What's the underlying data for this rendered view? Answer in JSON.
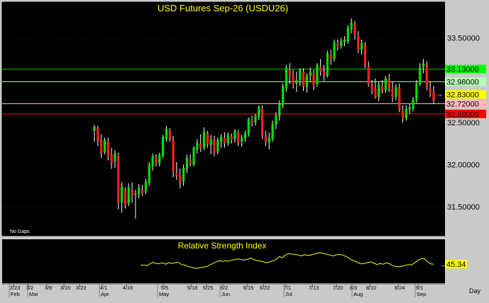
{
  "chart_data": {
    "type": "candlestick",
    "title": "USD Futures Sep-26  (USDU26)",
    "note": "No Gaps",
    "period_label": "Day",
    "y_ticks": [
      "33.50000",
      "33.00000",
      "32.50000",
      "32.00000",
      "31.50000"
    ],
    "ylim": [
      31.2,
      33.78
    ],
    "x_ticks": [
      "2/23",
      "3/2",
      "3/9",
      "3/16",
      "3/23",
      "4/1",
      "4/16",
      "5/5",
      "5/18",
      "5/25",
      "6/2",
      "6/15",
      "6/22",
      "7/1",
      "7/13",
      "7/20",
      "8/3",
      "8/10",
      "8/24",
      "9/1"
    ],
    "months": [
      "Feb",
      "Mar",
      "Apr",
      "May",
      "Jun",
      "Jul",
      "Aug",
      "Sep"
    ],
    "levels": [
      {
        "value": 33.13,
        "label": "33.13000",
        "color": "#00c800",
        "label_bg": "#00ff00"
      },
      {
        "value": 32.98,
        "label": "32.98000",
        "color": "#a8f0a8",
        "label_bg": "#b4ffb4"
      },
      {
        "value": 32.83,
        "label": "32.83000",
        "color": null,
        "label_bg": "#ffff00"
      },
      {
        "value": 32.72,
        "label": "32.72000",
        "color": "#ffbcbc",
        "label_bg": "#ffb8b8"
      },
      {
        "value": 32.6,
        "label": "32.60000",
        "color": "#ff0000",
        "label_bg": "#ff0000"
      }
    ],
    "candles": [
      {
        "o": 32.4,
        "h": 32.47,
        "l": 32.27,
        "c": 32.45
      },
      {
        "o": 32.43,
        "h": 32.46,
        "l": 32.22,
        "c": 32.28
      },
      {
        "o": 32.3,
        "h": 32.36,
        "l": 32.08,
        "c": 32.14
      },
      {
        "o": 32.15,
        "h": 32.32,
        "l": 32.12,
        "c": 32.29
      },
      {
        "o": 32.27,
        "h": 32.32,
        "l": 32.05,
        "c": 32.1
      },
      {
        "o": 32.12,
        "h": 32.2,
        "l": 31.95,
        "c": 32.02
      },
      {
        "o": 32.04,
        "h": 32.17,
        "l": 31.96,
        "c": 32.13
      },
      {
        "o": 32.1,
        "h": 32.14,
        "l": 31.47,
        "c": 31.55
      },
      {
        "o": 31.55,
        "h": 31.79,
        "l": 31.43,
        "c": 31.74
      },
      {
        "o": 31.7,
        "h": 31.73,
        "l": 31.48,
        "c": 31.52
      },
      {
        "o": 31.54,
        "h": 31.78,
        "l": 31.51,
        "c": 31.73
      },
      {
        "o": 31.7,
        "h": 31.79,
        "l": 31.55,
        "c": 31.63
      },
      {
        "o": 31.64,
        "h": 31.7,
        "l": 31.36,
        "c": 31.66
      },
      {
        "o": 31.65,
        "h": 31.77,
        "l": 31.6,
        "c": 31.73
      },
      {
        "o": 31.71,
        "h": 31.76,
        "l": 31.63,
        "c": 31.66
      },
      {
        "o": 31.68,
        "h": 31.83,
        "l": 31.65,
        "c": 31.8
      },
      {
        "o": 31.78,
        "h": 32.03,
        "l": 31.75,
        "c": 32.0
      },
      {
        "o": 31.98,
        "h": 32.13,
        "l": 31.93,
        "c": 32.1
      },
      {
        "o": 32.08,
        "h": 32.12,
        "l": 31.98,
        "c": 32.02
      },
      {
        "o": 32.01,
        "h": 32.14,
        "l": 31.98,
        "c": 32.12
      },
      {
        "o": 32.1,
        "h": 32.35,
        "l": 32.08,
        "c": 32.33
      },
      {
        "o": 32.3,
        "h": 32.46,
        "l": 32.27,
        "c": 32.42
      },
      {
        "o": 32.4,
        "h": 32.43,
        "l": 32.27,
        "c": 32.3
      },
      {
        "o": 32.3,
        "h": 32.34,
        "l": 31.85,
        "c": 31.92
      },
      {
        "o": 31.9,
        "h": 32.03,
        "l": 31.82,
        "c": 31.87
      },
      {
        "o": 31.88,
        "h": 31.95,
        "l": 31.72,
        "c": 31.8
      },
      {
        "o": 31.8,
        "h": 32.0,
        "l": 31.75,
        "c": 31.96
      },
      {
        "o": 31.95,
        "h": 32.12,
        "l": 31.9,
        "c": 32.08
      },
      {
        "o": 32.05,
        "h": 32.12,
        "l": 31.98,
        "c": 32.01
      },
      {
        "o": 32.0,
        "h": 32.22,
        "l": 31.98,
        "c": 32.2
      },
      {
        "o": 32.18,
        "h": 32.3,
        "l": 32.13,
        "c": 32.26
      },
      {
        "o": 32.25,
        "h": 32.36,
        "l": 32.15,
        "c": 32.19
      },
      {
        "o": 32.2,
        "h": 32.44,
        "l": 32.17,
        "c": 32.39
      },
      {
        "o": 32.37,
        "h": 32.4,
        "l": 32.2,
        "c": 32.24
      },
      {
        "o": 32.23,
        "h": 32.35,
        "l": 32.12,
        "c": 32.3
      },
      {
        "o": 32.3,
        "h": 32.34,
        "l": 32.1,
        "c": 32.14
      },
      {
        "o": 32.15,
        "h": 32.32,
        "l": 32.12,
        "c": 32.29
      },
      {
        "o": 32.27,
        "h": 32.36,
        "l": 32.2,
        "c": 32.33
      },
      {
        "o": 32.32,
        "h": 32.38,
        "l": 32.2,
        "c": 32.25
      },
      {
        "o": 32.25,
        "h": 32.38,
        "l": 32.22,
        "c": 32.35
      },
      {
        "o": 32.33,
        "h": 32.37,
        "l": 32.25,
        "c": 32.3
      },
      {
        "o": 32.3,
        "h": 32.42,
        "l": 32.26,
        "c": 32.4
      },
      {
        "o": 32.38,
        "h": 32.41,
        "l": 32.22,
        "c": 32.26
      },
      {
        "o": 32.27,
        "h": 32.35,
        "l": 32.21,
        "c": 32.32
      },
      {
        "o": 32.31,
        "h": 32.4,
        "l": 32.27,
        "c": 32.37
      },
      {
        "o": 32.36,
        "h": 32.56,
        "l": 32.33,
        "c": 32.54
      },
      {
        "o": 32.52,
        "h": 32.58,
        "l": 32.45,
        "c": 32.5
      },
      {
        "o": 32.5,
        "h": 32.6,
        "l": 32.46,
        "c": 32.58
      },
      {
        "o": 32.56,
        "h": 32.7,
        "l": 32.53,
        "c": 32.68
      },
      {
        "o": 32.66,
        "h": 32.7,
        "l": 32.3,
        "c": 32.35
      },
      {
        "o": 32.34,
        "h": 32.4,
        "l": 32.22,
        "c": 32.27
      },
      {
        "o": 32.26,
        "h": 32.38,
        "l": 32.18,
        "c": 32.32
      },
      {
        "o": 32.3,
        "h": 32.52,
        "l": 32.27,
        "c": 32.48
      },
      {
        "o": 32.47,
        "h": 32.62,
        "l": 32.42,
        "c": 32.58
      },
      {
        "o": 32.57,
        "h": 32.76,
        "l": 32.52,
        "c": 32.72
      },
      {
        "o": 32.7,
        "h": 32.96,
        "l": 32.67,
        "c": 32.93
      },
      {
        "o": 32.9,
        "h": 33.18,
        "l": 32.86,
        "c": 33.15
      },
      {
        "o": 33.13,
        "h": 33.2,
        "l": 32.95,
        "c": 33.05
      },
      {
        "o": 33.05,
        "h": 33.12,
        "l": 32.9,
        "c": 32.95
      },
      {
        "o": 32.96,
        "h": 33.1,
        "l": 32.86,
        "c": 33.0
      },
      {
        "o": 33.0,
        "h": 33.14,
        "l": 32.93,
        "c": 33.12
      },
      {
        "o": 33.1,
        "h": 33.14,
        "l": 32.87,
        "c": 32.92
      },
      {
        "o": 32.92,
        "h": 33.08,
        "l": 32.85,
        "c": 33.05
      },
      {
        "o": 33.05,
        "h": 33.15,
        "l": 32.98,
        "c": 33.1
      },
      {
        "o": 33.08,
        "h": 33.12,
        "l": 32.88,
        "c": 32.94
      },
      {
        "o": 32.95,
        "h": 33.2,
        "l": 32.92,
        "c": 33.18
      },
      {
        "o": 33.16,
        "h": 33.25,
        "l": 33.05,
        "c": 33.1
      },
      {
        "o": 33.1,
        "h": 33.18,
        "l": 32.99,
        "c": 33.05
      },
      {
        "o": 33.05,
        "h": 33.35,
        "l": 33.03,
        "c": 33.32
      },
      {
        "o": 33.3,
        "h": 33.36,
        "l": 33.18,
        "c": 33.24
      },
      {
        "o": 33.25,
        "h": 33.48,
        "l": 33.22,
        "c": 33.45
      },
      {
        "o": 33.43,
        "h": 33.48,
        "l": 33.35,
        "c": 33.4
      },
      {
        "o": 33.4,
        "h": 33.5,
        "l": 33.37,
        "c": 33.46
      },
      {
        "o": 33.45,
        "h": 33.52,
        "l": 33.4,
        "c": 33.48
      },
      {
        "o": 33.46,
        "h": 33.65,
        "l": 33.43,
        "c": 33.62
      },
      {
        "o": 33.6,
        "h": 33.73,
        "l": 33.55,
        "c": 33.68
      },
      {
        "o": 33.66,
        "h": 33.7,
        "l": 33.48,
        "c": 33.54
      },
      {
        "o": 33.53,
        "h": 33.58,
        "l": 33.32,
        "c": 33.36
      },
      {
        "o": 33.36,
        "h": 33.48,
        "l": 33.3,
        "c": 33.44
      },
      {
        "o": 33.42,
        "h": 33.45,
        "l": 33.14,
        "c": 33.17
      },
      {
        "o": 33.16,
        "h": 33.22,
        "l": 32.92,
        "c": 32.95
      },
      {
        "o": 32.95,
        "h": 33.0,
        "l": 32.83,
        "c": 32.88
      },
      {
        "o": 32.9,
        "h": 33.02,
        "l": 32.78,
        "c": 32.8
      },
      {
        "o": 32.8,
        "h": 32.98,
        "l": 32.75,
        "c": 32.95
      },
      {
        "o": 32.93,
        "h": 33.0,
        "l": 32.84,
        "c": 32.88
      },
      {
        "o": 32.88,
        "h": 33.05,
        "l": 32.85,
        "c": 33.02
      },
      {
        "o": 33.0,
        "h": 33.07,
        "l": 32.86,
        "c": 32.9
      },
      {
        "o": 32.9,
        "h": 32.98,
        "l": 32.74,
        "c": 32.8
      },
      {
        "o": 32.8,
        "h": 32.95,
        "l": 32.76,
        "c": 32.92
      },
      {
        "o": 32.9,
        "h": 32.96,
        "l": 32.62,
        "c": 32.65
      },
      {
        "o": 32.64,
        "h": 32.7,
        "l": 32.5,
        "c": 32.55
      },
      {
        "o": 32.55,
        "h": 32.7,
        "l": 32.52,
        "c": 32.66
      },
      {
        "o": 32.65,
        "h": 32.72,
        "l": 32.6,
        "c": 32.68
      },
      {
        "o": 32.66,
        "h": 32.8,
        "l": 32.63,
        "c": 32.77
      },
      {
        "o": 32.76,
        "h": 33.0,
        "l": 32.73,
        "c": 32.96
      },
      {
        "o": 32.95,
        "h": 33.2,
        "l": 32.93,
        "c": 33.15
      },
      {
        "o": 33.15,
        "h": 33.25,
        "l": 33.08,
        "c": 33.2
      },
      {
        "o": 33.18,
        "h": 33.22,
        "l": 32.88,
        "c": 32.92
      },
      {
        "o": 32.9,
        "h": 32.98,
        "l": 32.8,
        "c": 32.85
      },
      {
        "o": 32.86,
        "h": 32.93,
        "l": 32.72,
        "c": 32.76
      }
    ],
    "rsi": {
      "title": "Relative Strength Index",
      "ticks": [
        "50"
      ],
      "ylim": [
        0,
        100
      ],
      "current_label": "45.34",
      "values": [
        43,
        44,
        42,
        47,
        51,
        47,
        48,
        49,
        46,
        50,
        48,
        50,
        51,
        45,
        44,
        40,
        38,
        36,
        35,
        37,
        38,
        40,
        44,
        48,
        52,
        55,
        53,
        55,
        54,
        57,
        58,
        60,
        58,
        57,
        59,
        62,
        58,
        55,
        54,
        52,
        50,
        52,
        55,
        58,
        66,
        63,
        70,
        74,
        72,
        72,
        70,
        68,
        71,
        69,
        70,
        72,
        75,
        76,
        74,
        72,
        70,
        68,
        70,
        72,
        70,
        67,
        63,
        57,
        54,
        50,
        47,
        48,
        50,
        52,
        49,
        45,
        48,
        46,
        50,
        47,
        42,
        40,
        39,
        41,
        43,
        45,
        44,
        50,
        56,
        60,
        61,
        53,
        47,
        46
      ]
    }
  }
}
